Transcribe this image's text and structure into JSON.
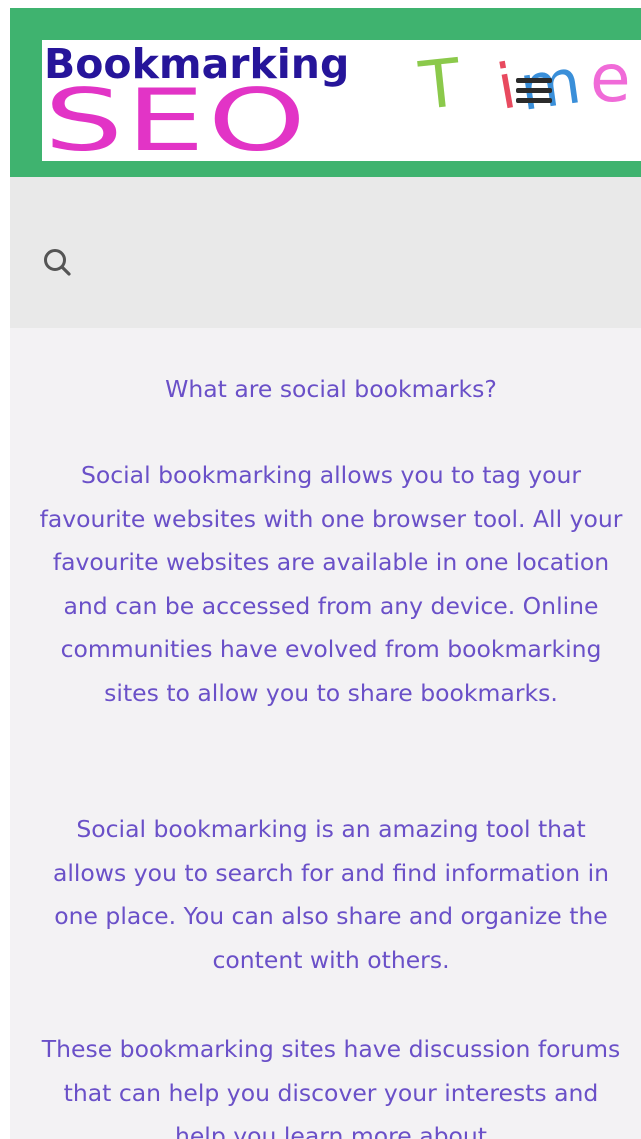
{
  "header": {
    "logo_line1": "Bookmarking",
    "logo_line2": "SEO",
    "logo_t": "T",
    "logo_i": "i",
    "logo_m": "m",
    "logo_e": "e",
    "menu_icon": "hamburger-menu-icon"
  },
  "search": {
    "icon": "search-icon"
  },
  "article": {
    "heading": "What are social bookmarks?",
    "paragraphs": [
      "Social bookmarking allows you to tag your favourite websites with one browser tool. All your favourite websites are available in one location and can be accessed from any device. Online communities have evolved from bookmarking sites to allow you to share bookmarks.",
      "Social bookmarking is an amazing tool that allows you to search for and find information in one place. You can also share and organize the content with others.",
      "These bookmarking sites have discussion forums that can help you discover your interests and help you learn more about"
    ]
  },
  "colors": {
    "header_green": "#3fb36f",
    "text_purple": "#6a50c8",
    "logo_blue": "#26159a",
    "logo_magenta": "#e234c6",
    "search_band": "#e9e9e9",
    "page_bg": "#f3f2f4"
  }
}
